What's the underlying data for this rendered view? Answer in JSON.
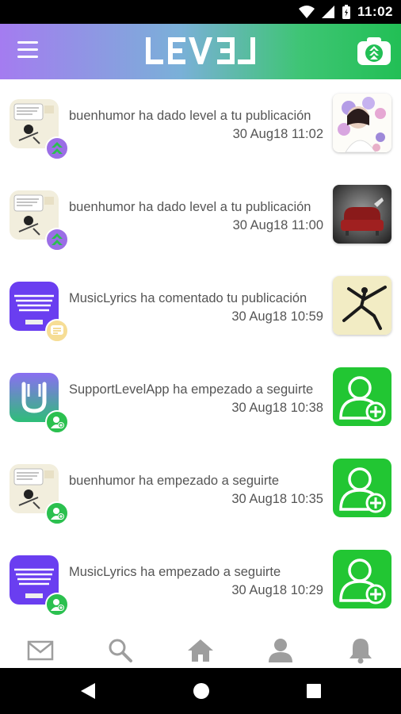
{
  "status_bar": {
    "time": "11:02"
  },
  "header": {
    "logo_text": "LEVEL",
    "menu_icon": "hamburger-menu-icon",
    "camera_icon": "camera-level-icon"
  },
  "notifications": [
    {
      "text": "buenhumor ha dado level a tu publicación",
      "timestamp": "30 Aug18 11:02",
      "avatar": "buenhumor-avatar",
      "badge": "level-up-icon",
      "thumbnail": "flower-portrait-photo"
    },
    {
      "text": "buenhumor ha dado level a tu publicación",
      "timestamp": "30 Aug18 11:00",
      "avatar": "buenhumor-avatar",
      "badge": "level-up-icon",
      "thumbnail": "red-sofa-photo"
    },
    {
      "text": "MusicLyrics ha comentado tu publicación",
      "timestamp": "30 Aug18 10:59",
      "avatar": "musiclyrics-avatar",
      "badge": "comment-icon",
      "thumbnail": "dancer-silhouette-photo"
    },
    {
      "text": "SupportLevelApp ha empezado a seguirte",
      "timestamp": "30 Aug18 10:38",
      "avatar": "supportlevelapp-avatar",
      "badge": "follow-user-icon",
      "thumbnail": "add-user-icon"
    },
    {
      "text": "buenhumor ha empezado a seguirte",
      "timestamp": "30 Aug18 10:35",
      "avatar": "buenhumor-avatar",
      "badge": "follow-user-icon",
      "thumbnail": "add-user-icon"
    },
    {
      "text": "MusicLyrics ha empezado a seguirte",
      "timestamp": "30 Aug18 10:29",
      "avatar": "musiclyrics-avatar",
      "badge": "follow-user-icon",
      "thumbnail": "add-user-icon"
    }
  ],
  "bottom_nav": [
    "mail-icon",
    "search-icon",
    "home-icon",
    "profile-icon",
    "notifications-bell-icon"
  ],
  "system_nav": [
    "back-icon",
    "home-circle-icon",
    "recents-icon"
  ],
  "colors": {
    "header_start": "#a47cf0",
    "header_end": "#22bf55",
    "follow_green": "#22c633",
    "level_purple": "#9b6ee6",
    "text": "#555555",
    "nav_icon": "#9e9e9e"
  }
}
